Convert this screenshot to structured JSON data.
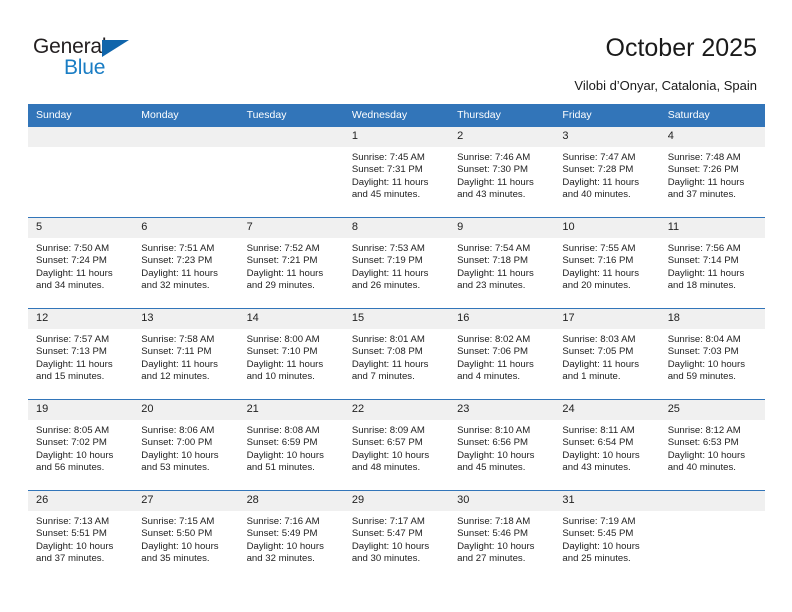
{
  "brand": {
    "name_part1": "General",
    "name_part2": "Blue",
    "triangle_icon": "blue-triangle-icon",
    "accent_color": "#1a7dc4"
  },
  "header": {
    "title": "October 2025",
    "subtitle": "Vilobi d’Onyar, Catalonia, Spain"
  },
  "calendar": {
    "header_bg": "#3275b9",
    "day_band_bg": "#f0f0f0",
    "weekdays": [
      "Sunday",
      "Monday",
      "Tuesday",
      "Wednesday",
      "Thursday",
      "Friday",
      "Saturday"
    ],
    "weeks": [
      [
        {
          "day": "",
          "empty": true
        },
        {
          "day": "",
          "empty": true
        },
        {
          "day": "",
          "empty": true
        },
        {
          "day": "1",
          "sunrise": "Sunrise: 7:45 AM",
          "sunset": "Sunset: 7:31 PM",
          "daylight_line1": "Daylight: 11 hours",
          "daylight_line2": "and 45 minutes."
        },
        {
          "day": "2",
          "sunrise": "Sunrise: 7:46 AM",
          "sunset": "Sunset: 7:30 PM",
          "daylight_line1": "Daylight: 11 hours",
          "daylight_line2": "and 43 minutes."
        },
        {
          "day": "3",
          "sunrise": "Sunrise: 7:47 AM",
          "sunset": "Sunset: 7:28 PM",
          "daylight_line1": "Daylight: 11 hours",
          "daylight_line2": "and 40 minutes."
        },
        {
          "day": "4",
          "sunrise": "Sunrise: 7:48 AM",
          "sunset": "Sunset: 7:26 PM",
          "daylight_line1": "Daylight: 11 hours",
          "daylight_line2": "and 37 minutes."
        }
      ],
      [
        {
          "day": "5",
          "sunrise": "Sunrise: 7:50 AM",
          "sunset": "Sunset: 7:24 PM",
          "daylight_line1": "Daylight: 11 hours",
          "daylight_line2": "and 34 minutes."
        },
        {
          "day": "6",
          "sunrise": "Sunrise: 7:51 AM",
          "sunset": "Sunset: 7:23 PM",
          "daylight_line1": "Daylight: 11 hours",
          "daylight_line2": "and 32 minutes."
        },
        {
          "day": "7",
          "sunrise": "Sunrise: 7:52 AM",
          "sunset": "Sunset: 7:21 PM",
          "daylight_line1": "Daylight: 11 hours",
          "daylight_line2": "and 29 minutes."
        },
        {
          "day": "8",
          "sunrise": "Sunrise: 7:53 AM",
          "sunset": "Sunset: 7:19 PM",
          "daylight_line1": "Daylight: 11 hours",
          "daylight_line2": "and 26 minutes."
        },
        {
          "day": "9",
          "sunrise": "Sunrise: 7:54 AM",
          "sunset": "Sunset: 7:18 PM",
          "daylight_line1": "Daylight: 11 hours",
          "daylight_line2": "and 23 minutes."
        },
        {
          "day": "10",
          "sunrise": "Sunrise: 7:55 AM",
          "sunset": "Sunset: 7:16 PM",
          "daylight_line1": "Daylight: 11 hours",
          "daylight_line2": "and 20 minutes."
        },
        {
          "day": "11",
          "sunrise": "Sunrise: 7:56 AM",
          "sunset": "Sunset: 7:14 PM",
          "daylight_line1": "Daylight: 11 hours",
          "daylight_line2": "and 18 minutes."
        }
      ],
      [
        {
          "day": "12",
          "sunrise": "Sunrise: 7:57 AM",
          "sunset": "Sunset: 7:13 PM",
          "daylight_line1": "Daylight: 11 hours",
          "daylight_line2": "and 15 minutes."
        },
        {
          "day": "13",
          "sunrise": "Sunrise: 7:58 AM",
          "sunset": "Sunset: 7:11 PM",
          "daylight_line1": "Daylight: 11 hours",
          "daylight_line2": "and 12 minutes."
        },
        {
          "day": "14",
          "sunrise": "Sunrise: 8:00 AM",
          "sunset": "Sunset: 7:10 PM",
          "daylight_line1": "Daylight: 11 hours",
          "daylight_line2": "and 10 minutes."
        },
        {
          "day": "15",
          "sunrise": "Sunrise: 8:01 AM",
          "sunset": "Sunset: 7:08 PM",
          "daylight_line1": "Daylight: 11 hours",
          "daylight_line2": "and 7 minutes."
        },
        {
          "day": "16",
          "sunrise": "Sunrise: 8:02 AM",
          "sunset": "Sunset: 7:06 PM",
          "daylight_line1": "Daylight: 11 hours",
          "daylight_line2": "and 4 minutes."
        },
        {
          "day": "17",
          "sunrise": "Sunrise: 8:03 AM",
          "sunset": "Sunset: 7:05 PM",
          "daylight_line1": "Daylight: 11 hours",
          "daylight_line2": "and 1 minute."
        },
        {
          "day": "18",
          "sunrise": "Sunrise: 8:04 AM",
          "sunset": "Sunset: 7:03 PM",
          "daylight_line1": "Daylight: 10 hours",
          "daylight_line2": "and 59 minutes."
        }
      ],
      [
        {
          "day": "19",
          "sunrise": "Sunrise: 8:05 AM",
          "sunset": "Sunset: 7:02 PM",
          "daylight_line1": "Daylight: 10 hours",
          "daylight_line2": "and 56 minutes."
        },
        {
          "day": "20",
          "sunrise": "Sunrise: 8:06 AM",
          "sunset": "Sunset: 7:00 PM",
          "daylight_line1": "Daylight: 10 hours",
          "daylight_line2": "and 53 minutes."
        },
        {
          "day": "21",
          "sunrise": "Sunrise: 8:08 AM",
          "sunset": "Sunset: 6:59 PM",
          "daylight_line1": "Daylight: 10 hours",
          "daylight_line2": "and 51 minutes."
        },
        {
          "day": "22",
          "sunrise": "Sunrise: 8:09 AM",
          "sunset": "Sunset: 6:57 PM",
          "daylight_line1": "Daylight: 10 hours",
          "daylight_line2": "and 48 minutes."
        },
        {
          "day": "23",
          "sunrise": "Sunrise: 8:10 AM",
          "sunset": "Sunset: 6:56 PM",
          "daylight_line1": "Daylight: 10 hours",
          "daylight_line2": "and 45 minutes."
        },
        {
          "day": "24",
          "sunrise": "Sunrise: 8:11 AM",
          "sunset": "Sunset: 6:54 PM",
          "daylight_line1": "Daylight: 10 hours",
          "daylight_line2": "and 43 minutes."
        },
        {
          "day": "25",
          "sunrise": "Sunrise: 8:12 AM",
          "sunset": "Sunset: 6:53 PM",
          "daylight_line1": "Daylight: 10 hours",
          "daylight_line2": "and 40 minutes."
        }
      ],
      [
        {
          "day": "26",
          "sunrise": "Sunrise: 7:13 AM",
          "sunset": "Sunset: 5:51 PM",
          "daylight_line1": "Daylight: 10 hours",
          "daylight_line2": "and 37 minutes."
        },
        {
          "day": "27",
          "sunrise": "Sunrise: 7:15 AM",
          "sunset": "Sunset: 5:50 PM",
          "daylight_line1": "Daylight: 10 hours",
          "daylight_line2": "and 35 minutes."
        },
        {
          "day": "28",
          "sunrise": "Sunrise: 7:16 AM",
          "sunset": "Sunset: 5:49 PM",
          "daylight_line1": "Daylight: 10 hours",
          "daylight_line2": "and 32 minutes."
        },
        {
          "day": "29",
          "sunrise": "Sunrise: 7:17 AM",
          "sunset": "Sunset: 5:47 PM",
          "daylight_line1": "Daylight: 10 hours",
          "daylight_line2": "and 30 minutes."
        },
        {
          "day": "30",
          "sunrise": "Sunrise: 7:18 AM",
          "sunset": "Sunset: 5:46 PM",
          "daylight_line1": "Daylight: 10 hours",
          "daylight_line2": "and 27 minutes."
        },
        {
          "day": "31",
          "sunrise": "Sunrise: 7:19 AM",
          "sunset": "Sunset: 5:45 PM",
          "daylight_line1": "Daylight: 10 hours",
          "daylight_line2": "and 25 minutes."
        },
        {
          "day": "",
          "empty": true
        }
      ]
    ]
  }
}
